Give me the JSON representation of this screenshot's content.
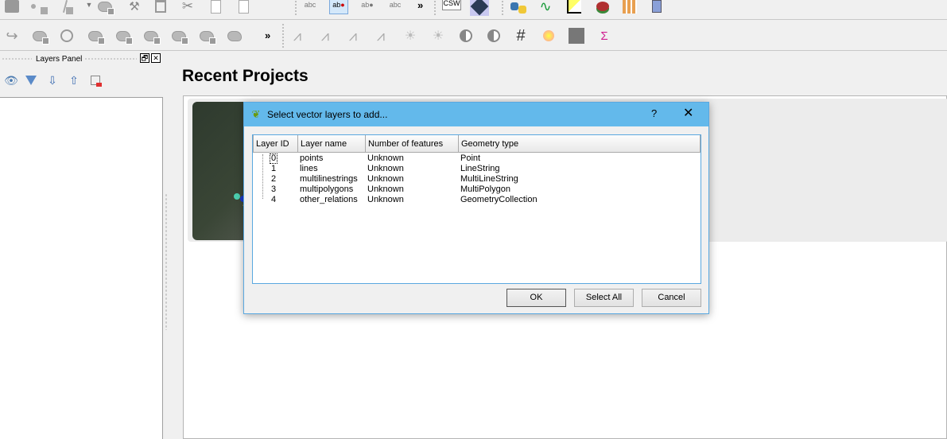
{
  "toolbar_top": {
    "icons": [
      "save-edits-icon",
      "add-point-icon",
      "add-line-icon",
      "add-polygon-icon",
      "vertex-tool-icon",
      "delete-selected-icon",
      "cut-features-icon",
      "copy-features-icon",
      "paste-features-icon",
      "label-icon",
      "pin-label-icon",
      "change-label-icon",
      "show-hide-labels-icon",
      "csw-icon",
      "map-tile-icon",
      "python-icon",
      "curve-icon",
      "profile-icon",
      "plugin-icon",
      "grid-icon",
      "robot-icon"
    ],
    "overflow": "»"
  },
  "toolbar_second": {
    "icons": [
      "redo-icon",
      "rotate-feature-icon",
      "simplify-icon",
      "add-ring-icon",
      "add-part-icon",
      "fill-ring-icon",
      "delete-ring-icon",
      "delete-part-icon",
      "reshape-icon",
      "histogram-icon",
      "stretch-icon",
      "histogram2-icon",
      "stretch2-icon",
      "brightness-up-icon",
      "brightness-down-icon",
      "contrast-up-icon",
      "contrast-down-icon",
      "graticule-icon",
      "heatmap-icon",
      "raster-points-icon",
      "zonal-stats-icon"
    ],
    "overflow": "»",
    "csw_label": "CSW"
  },
  "layers_panel": {
    "title": "Layers Panel",
    "float_label": "🗗",
    "close_label": "✕"
  },
  "main": {
    "recent_title": "Recent Projects"
  },
  "dialog": {
    "title": "Select vector layers to add...",
    "help": "?",
    "close": "✕",
    "columns": [
      "Layer ID",
      "Layer name",
      "Number of features",
      "Geometry type"
    ],
    "rows": [
      {
        "id": "0",
        "name": "points",
        "features": "Unknown",
        "geometry": "Point"
      },
      {
        "id": "1",
        "name": "lines",
        "features": "Unknown",
        "geometry": "LineString"
      },
      {
        "id": "2",
        "name": "multilinestrings",
        "features": "Unknown",
        "geometry": "MultiLineString"
      },
      {
        "id": "3",
        "name": "multipolygons",
        "features": "Unknown",
        "geometry": "MultiPolygon"
      },
      {
        "id": "4",
        "name": "other_relations",
        "features": "Unknown",
        "geometry": "GeometryCollection"
      }
    ],
    "buttons": {
      "ok": "OK",
      "select_all": "Select All",
      "cancel": "Cancel"
    }
  }
}
